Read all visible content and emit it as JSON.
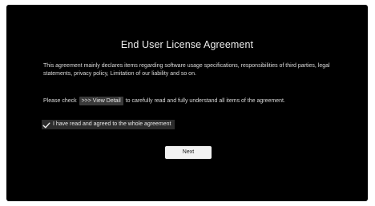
{
  "dialog": {
    "title": "End User License Agreement",
    "description": "This agreement mainly declares items regarding software usage specifications, responsibilities of third parties, legal statements, privacy policy, Limitation of our liability and so on.",
    "check_prefix": "Please check",
    "view_detail_label": ">>> View Detail",
    "check_suffix": "to carefully read and fully understand all items of the agreement.",
    "agree_label": "I have read and agreed to the whole agreement",
    "agree_checked": true,
    "next_label": "Next"
  },
  "icons": {
    "agree_check": "check-icon"
  },
  "colors": {
    "background": "#000000",
    "text": "#dcdcdc",
    "link_background": "#3a3a3a",
    "button_background": "#f2f2f2"
  }
}
